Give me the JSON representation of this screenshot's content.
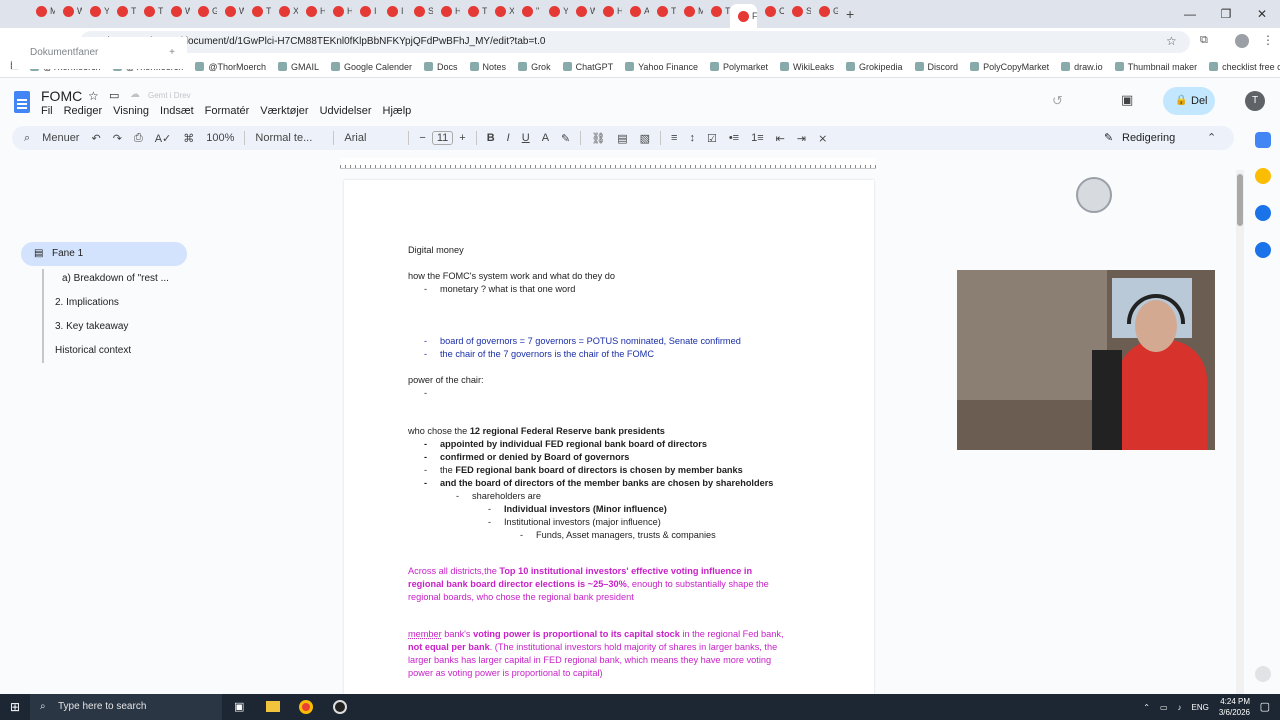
{
  "browser": {
    "tabs": [
      "M",
      "W",
      "Y",
      "T",
      "T",
      "W",
      "G",
      "W",
      "T",
      "X",
      "H",
      "H",
      "I",
      "I",
      "S",
      "H",
      "T",
      "X",
      "\"",
      "Y",
      "W",
      "H",
      "A",
      "T",
      "M",
      "T",
      "F",
      "C",
      "S",
      "G"
    ],
    "active_tab_index": 26,
    "new_tab": "+",
    "url": "docs.google.com/document/d/1GwPlci-H7CM88TEKnl0fKlpBbNFKYpjQFdPwBFhJ_MY/edit?tab=t.0",
    "bookmarks": [
      "@ThorMoerch",
      "@ThorMoerch",
      "@ThorMoerch",
      "GMAIL",
      "Google Calender",
      "Docs",
      "Notes",
      "Grok",
      "ChatGPT",
      "Yahoo Finance",
      "Polymarket",
      "WikiLeaks",
      "Grokipedia",
      "Discord",
      "PolyCopyMarket",
      "draw.io",
      "Thumbnail maker",
      "checklist free online"
    ]
  },
  "doc": {
    "title": "FOMC",
    "save_status": "Gemt i Drev",
    "menu": [
      "Fil",
      "Rediger",
      "Visning",
      "Indsæt",
      "Formatér",
      "Værktøjer",
      "Udvidelser",
      "Hjælp"
    ],
    "share_label": "Del",
    "avatar_letter": "T"
  },
  "toolbar": {
    "menus_label": "Menuer",
    "zoom": "100%",
    "style": "Normal te...",
    "font": "Arial",
    "font_size": "11",
    "edit_mode": "Redigering"
  },
  "sidepanel": {
    "header": "Dokumentfaner",
    "add": "+",
    "tab_label": "Fane 1",
    "outline": [
      "a) Breakdown of \"rest ...",
      "2. Implications",
      "3. Key takeaway",
      "Historical context"
    ]
  },
  "content": {
    "l1": "Digital money",
    "l2": "how the FOMC's system work and what do they do",
    "l3": "monetary ? what is that one word",
    "l4": "board of governors = 7 governors = POTUS nominated, Senate confirmed",
    "l5": "the chair of the 7 governors is the chair of the FOMC",
    "l6": "power of the chair:",
    "l7a": "who chose the ",
    "l7b": "12 regional Federal Reserve bank presidents",
    "l8": "appointed by individual FED regional bank board of directors",
    "l9": "confirmed or denied by Board of governors",
    "l10a": "the ",
    "l10b": "FED regional bank board of directors is chosen by member banks",
    "l11": "and the board of directors of the member banks are chosen by shareholders",
    "l12": "shareholders are",
    "l13": "Individual investors (Minor influence)",
    "l14": "Institutional investors (major influence)",
    "l15": "Funds, Asset managers, trusts & companies",
    "p1a": "Across all districts,the ",
    "p1b": "Top 10 institutional investors' effective voting influence in",
    "p1c": "regional bank board director elections is ~25–30%",
    "p1d": ", enough to substantially shape the",
    "p1e": "regional boards, who chose the regional bank president",
    "p2a": "member",
    "p2b": " bank's ",
    "p2c": "voting power is proportional to its capital stock",
    "p2d": " in the regional Fed bank,",
    "p2e": "not equal per bank",
    "p2f": ". (The institutional investors hold majority of shares in larger banks, the",
    "p2g": "larger banks has larger capital in FED regional bank, which means they have more voting",
    "p2h": "power as voting power is proportional to capital)",
    "dash": "-"
  },
  "taskbar": {
    "search_placeholder": "Type here to search",
    "lang": "ENG",
    "time": "4:24 PM",
    "date": "3/6/2026"
  },
  "colors": {
    "blue_text": "#1a2ea7",
    "pink_text": "#c822c8",
    "share_bg": "#c2e7ff",
    "toolbar_bg": "#edf2fa"
  }
}
